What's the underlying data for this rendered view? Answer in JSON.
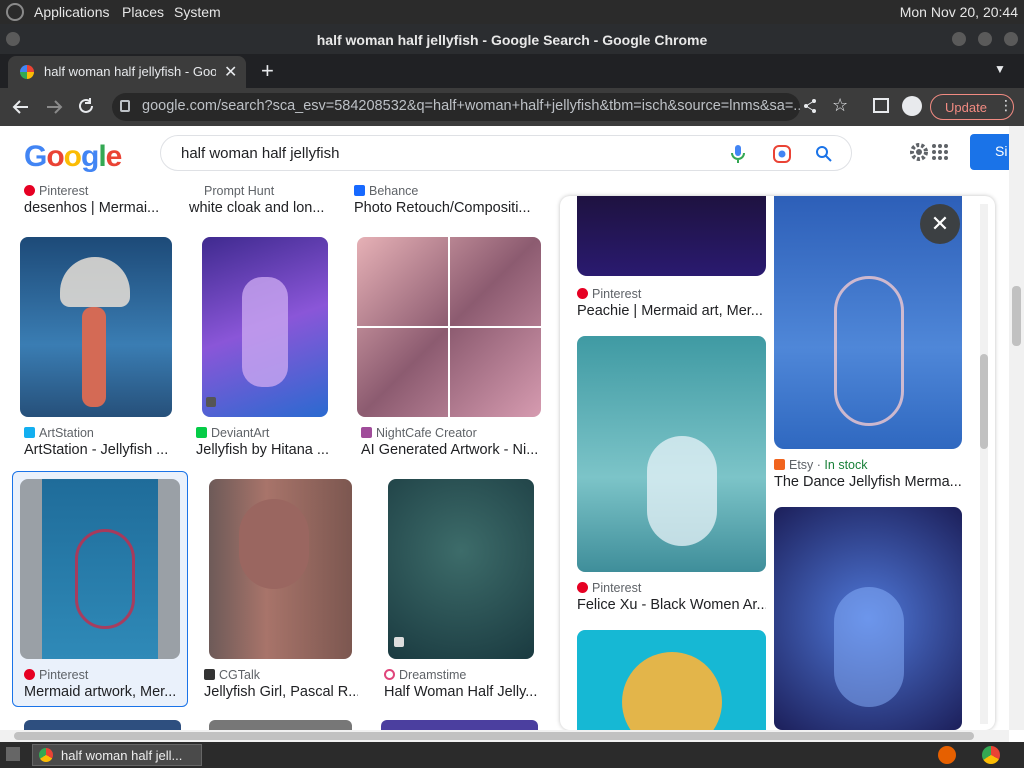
{
  "os": {
    "menu": [
      "Applications",
      "Places",
      "System"
    ],
    "clock": "Mon Nov 20, 20:44"
  },
  "window": {
    "title": "half woman half jellyfish - Google Search - Google Chrome"
  },
  "tab": {
    "title": "half woman half jellyfish - Goo"
  },
  "address": {
    "url": "google.com/search?sca_esv=584208532&q=half+woman+half+jellyfish&tbm=isch&source=lnms&sa=..."
  },
  "toolbar": {
    "update_label": "Update"
  },
  "search": {
    "query": "half woman half jellyfish",
    "signin_label": "Si"
  },
  "results": {
    "top_row": [
      {
        "source": "Pinterest",
        "title": "desenhos | Mermai..."
      },
      {
        "source": "Prompt Hunt",
        "title": "white cloak and lon..."
      },
      {
        "source": "Behance",
        "title": "Photo Retouch/Compositi..."
      }
    ],
    "row1": [
      {
        "source": "ArtStation",
        "title": "ArtStation - Jellyfish ..."
      },
      {
        "source": "DeviantArt",
        "title": "Jellyfish by Hitana ..."
      },
      {
        "source": "NightCafe Creator",
        "title": "AI Generated Artwork - Ni..."
      }
    ],
    "row2": [
      {
        "source": "Pinterest",
        "title": "Mermaid artwork, Mer..."
      },
      {
        "source": "CGTalk",
        "title": "Jellyfish Girl, Pascal R..."
      },
      {
        "source": "Dreamstime",
        "title": "Half Woman Half Jelly..."
      }
    ]
  },
  "panel": {
    "col1": [
      {
        "source": "Pinterest",
        "title": "Peachie | Mermaid art, Mer..."
      },
      {
        "source": "Pinterest",
        "title": "Felice Xu - Black Women Ar..."
      }
    ],
    "col2": [
      {
        "source": "Etsy",
        "stock": "In stock",
        "title": "The Dance Jellyfish Merma..."
      }
    ]
  },
  "taskbar": {
    "window_label": "half woman half jell..."
  },
  "colors": {
    "google_blue": "#1a73e8",
    "pinterest": "#e60023",
    "etsy_green": "#188038"
  }
}
